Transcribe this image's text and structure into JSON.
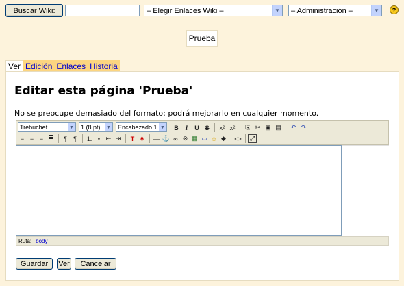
{
  "topbar": {
    "search_button": "Buscar Wiki:",
    "search_value": "",
    "links_select": "Elegir Enlaces Wiki –",
    "admin_select": "– Administración –",
    "help_glyph": "?"
  },
  "page_name": "Prueba",
  "tabs": [
    {
      "label": "Ver"
    },
    {
      "label": "Edición"
    },
    {
      "label": "Enlaces"
    },
    {
      "label": "Historia"
    }
  ],
  "main": {
    "title": "Editar esta página 'Prueba'",
    "hint": "No se preocupe demasiado del formato: podrá mejorarlo en cualquier momento."
  },
  "editor": {
    "font_select": "Trebuchet",
    "size_select": "1 (8 pt)",
    "format_select": "Encabezado 1",
    "status_label": "Ruta:",
    "status_path": "body",
    "icons_row1": [
      "bold-icon",
      "italic-icon",
      "underline-icon",
      "strikethrough-icon",
      "subscript-icon",
      "superscript-icon",
      "copy-icon",
      "cut-icon",
      "paste-icon",
      "paste-word-icon",
      "undo-icon",
      "redo-icon"
    ],
    "icons_row2": [
      "align-left-icon",
      "align-center-icon",
      "align-right-icon",
      "justify-icon",
      "ltr-icon",
      "rtl-icon",
      "ordered-list-icon",
      "unordered-list-icon",
      "outdent-icon",
      "indent-icon",
      "text-color-icon",
      "bg-color-icon",
      "hr-icon",
      "anchor-icon",
      "link-icon",
      "unlink-icon",
      "image-icon",
      "table-icon",
      "smiley-icon",
      "special-char-icon",
      "source-icon",
      "fullscreen-icon"
    ]
  },
  "actions": {
    "save": "Guardar",
    "preview": "Ver",
    "cancel": "Cancelar"
  },
  "colors": {
    "background": "#fdf3dc",
    "tab_bg": "#fcd580",
    "link": "#0000cc"
  }
}
